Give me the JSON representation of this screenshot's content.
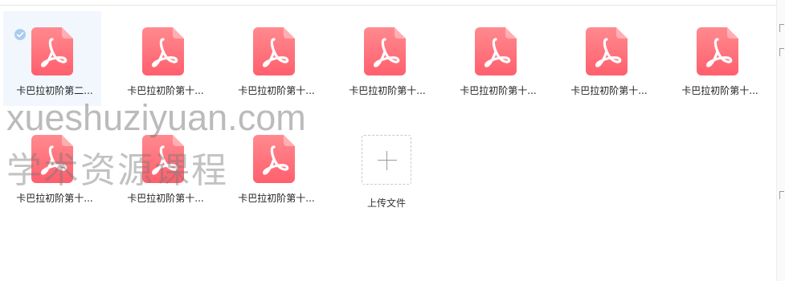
{
  "files": [
    {
      "name": "卡巴拉初阶第二...",
      "selected": true
    },
    {
      "name": "卡巴拉初阶第十...",
      "selected": false
    },
    {
      "name": "卡巴拉初阶第十...",
      "selected": false
    },
    {
      "name": "卡巴拉初阶第十...",
      "selected": false
    },
    {
      "name": "卡巴拉初阶第十...",
      "selected": false
    },
    {
      "name": "卡巴拉初阶第十...",
      "selected": false
    },
    {
      "name": "卡巴拉初阶第十...",
      "selected": false
    },
    {
      "name": "卡巴拉初阶第十...",
      "selected": false
    },
    {
      "name": "卡巴拉初阶第十...",
      "selected": false
    },
    {
      "name": "卡巴拉初阶第十...",
      "selected": false
    }
  ],
  "upload": {
    "label": "上传文件",
    "icon": "plus-icon"
  },
  "file_icon": "pdf-file-icon",
  "watermark": {
    "line1": "xueshuziyuan.com",
    "line2": "学术资源课程"
  },
  "colors": {
    "pdf_top": "#ff8a8f",
    "pdf_bottom": "#ff5f6d",
    "selected_bg": "#f1f7fd",
    "check": "#a9cdf0"
  }
}
